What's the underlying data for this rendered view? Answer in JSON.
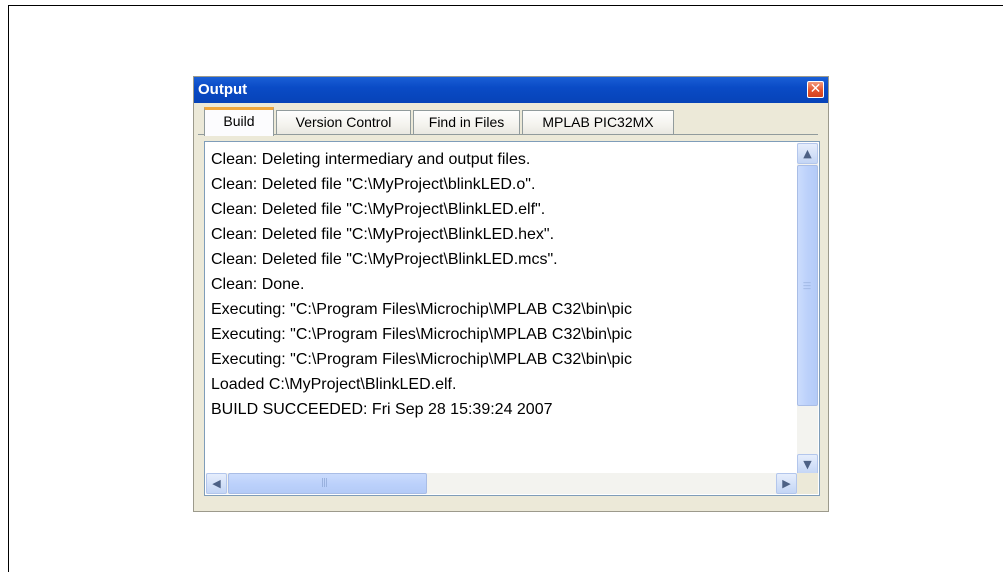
{
  "window": {
    "title": "Output",
    "close_glyph": "✕"
  },
  "tabs": [
    {
      "label": "Build",
      "active": true
    },
    {
      "label": "Version Control",
      "active": false
    },
    {
      "label": "Find in Files",
      "active": false
    },
    {
      "label": "MPLAB PIC32MX",
      "active": false
    }
  ],
  "log": {
    "lines": [
      "Clean: Deleting intermediary and output files.",
      "Clean: Deleted file \"C:\\MyProject\\blinkLED.o\".",
      "Clean: Deleted file \"C:\\MyProject\\BlinkLED.elf\".",
      "Clean: Deleted file \"C:\\MyProject\\BlinkLED.hex\".",
      "Clean: Deleted file \"C:\\MyProject\\BlinkLED.mcs\".",
      "Clean: Done.",
      "Executing: \"C:\\Program Files\\Microchip\\MPLAB C32\\bin\\pic",
      "Executing: \"C:\\Program Files\\Microchip\\MPLAB C32\\bin\\pic",
      "Executing: \"C:\\Program Files\\Microchip\\MPLAB C32\\bin\\pic",
      "Loaded C:\\MyProject\\BlinkLED.elf.",
      "BUILD SUCCEEDED: Fri Sep 28 15:39:24 2007"
    ]
  },
  "scrollbars": {
    "up_glyph": "▲",
    "down_glyph": "▼",
    "left_glyph": "◀",
    "right_glyph": "▶"
  },
  "icons": {
    "close": "close-icon",
    "up": "chevron-up-icon",
    "down": "chevron-down-icon",
    "left": "chevron-left-icon",
    "right": "chevron-right-icon"
  },
  "colors": {
    "titlebar": "#0a4bc6",
    "active_tab_accent": "#f0a73c",
    "close_button": "#e5542c"
  }
}
